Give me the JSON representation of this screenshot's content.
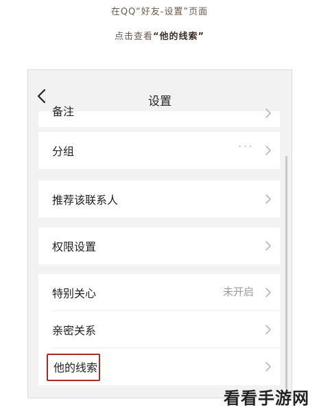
{
  "caption": {
    "line1": "在QQ“好友-设置”页面",
    "line2_prefix": "点击查看",
    "line2_emphasis": "“他的线索”"
  },
  "navbar": {
    "back_icon": "chevron-left-icon",
    "title": "设置"
  },
  "settings": {
    "partial_item": {
      "label": "备注"
    },
    "items": [
      {
        "label": "分组",
        "value": "···"
      },
      {
        "label": "推荐该联系人"
      },
      {
        "label": "权限设置"
      },
      {
        "label": "特别关心",
        "value": "未开启"
      },
      {
        "label": "亲密关系"
      },
      {
        "label": "他的线索",
        "highlighted": true
      }
    ]
  },
  "colors": {
    "highlight_border": "#a52a2a",
    "caption_text": "#6b5a4e",
    "page_background": "#f2f2f2"
  },
  "watermark": "看看手游网"
}
